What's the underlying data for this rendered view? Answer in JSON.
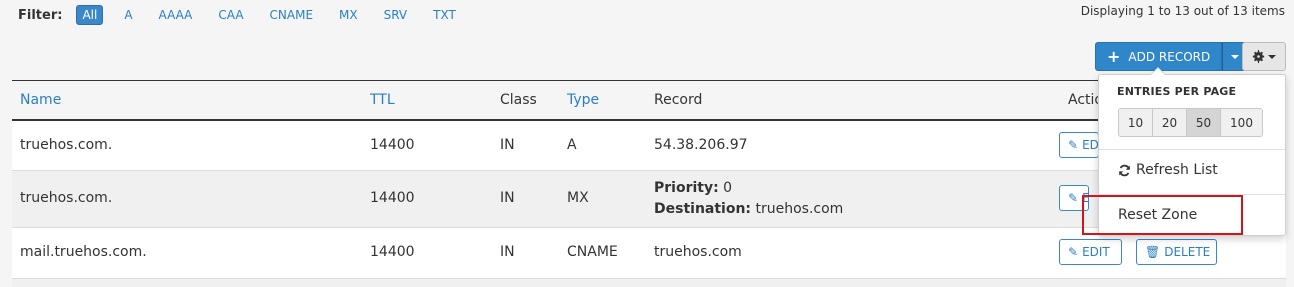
{
  "filter": {
    "label": "Filter:",
    "options": [
      "All",
      "A",
      "AAAA",
      "CAA",
      "CNAME",
      "MX",
      "SRV",
      "TXT"
    ],
    "active": "All"
  },
  "displaying": "Displaying 1 to 13 out of 13 items",
  "toolbar": {
    "add_record_label": "ADD RECORD",
    "add_icon": "plus-icon",
    "gear_icon": "gear-icon"
  },
  "table": {
    "headers": {
      "name": "Name",
      "ttl": "TTL",
      "class": "Class",
      "type": "Type",
      "record": "Record",
      "actions": "Actio"
    },
    "rows": [
      {
        "name": "truehos.com.",
        "ttl": "14400",
        "class": "IN",
        "type": "A",
        "record": "54.38.206.97",
        "edit": "ED"
      },
      {
        "name": "truehos.com.",
        "ttl": "14400",
        "class": "IN",
        "type": "MX",
        "priority_label": "Priority:",
        "priority_value": " 0",
        "destination_label": "Destination:",
        "destination_value": " truehos.com",
        "edit": "E"
      },
      {
        "name": "mail.truehos.com.",
        "ttl": "14400",
        "class": "IN",
        "type": "CNAME",
        "record": "truehos.com",
        "edit": "EDIT",
        "delete": "DELETE"
      }
    ]
  },
  "dropdown": {
    "entries_title": "ENTRIES PER PAGE",
    "page_sizes": [
      "10",
      "20",
      "50",
      "100"
    ],
    "selected_page_size": "50",
    "refresh_label": "Refresh List",
    "reset_label": "Reset Zone"
  },
  "colors": {
    "accent": "#2f86c9",
    "link": "#2a7fc4",
    "highlight": "#d0161c"
  }
}
